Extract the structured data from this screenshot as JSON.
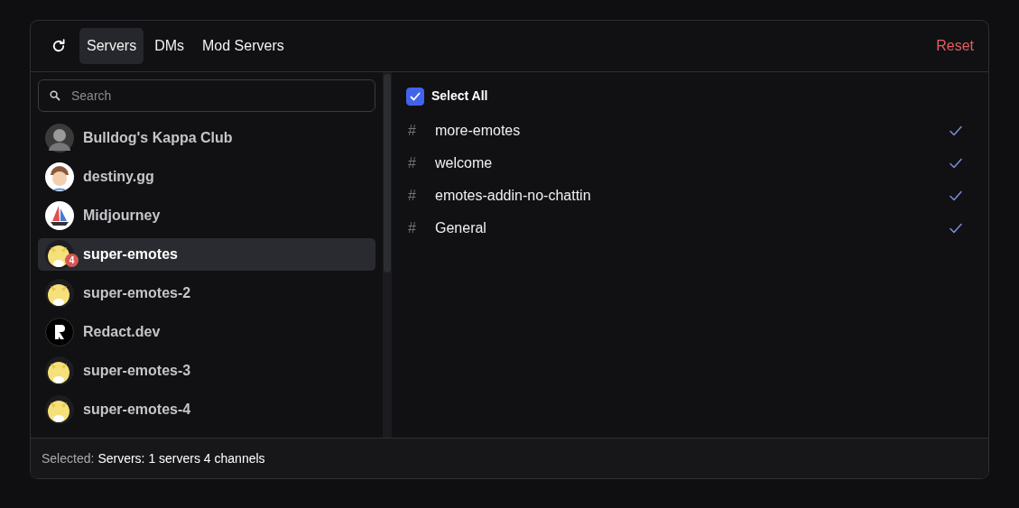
{
  "tabs": [
    {
      "label": "Servers",
      "selected": true
    },
    {
      "label": "DMs",
      "selected": false
    },
    {
      "label": "Mod Servers",
      "selected": false
    }
  ],
  "reset": "Reset",
  "search": {
    "placeholder": "Search"
  },
  "servers": [
    {
      "name": "Bulldog's Kappa Club",
      "kind": "person",
      "selected": false
    },
    {
      "name": "destiny.gg",
      "kind": "cartoon",
      "selected": false
    },
    {
      "name": "Midjourney",
      "kind": "boat",
      "selected": false
    },
    {
      "name": "super-emotes",
      "kind": "yellow",
      "selected": true,
      "badge": "4"
    },
    {
      "name": "super-emotes-2",
      "kind": "yellow",
      "selected": false
    },
    {
      "name": "Redact.dev",
      "kind": "dark",
      "selected": false
    },
    {
      "name": "super-emotes-3",
      "kind": "yellow",
      "selected": false
    },
    {
      "name": "super-emotes-4",
      "kind": "yellow",
      "selected": false
    }
  ],
  "select_all": {
    "label": "Select All",
    "checked": true
  },
  "channels": [
    {
      "prefix": "#",
      "name": "more-emotes",
      "checked": true
    },
    {
      "prefix": "#",
      "name": "welcome",
      "checked": true
    },
    {
      "prefix": "#",
      "name": "emotes-addin-no-chattin",
      "checked": true
    },
    {
      "prefix": "#",
      "name": "General",
      "checked": true
    }
  ],
  "status_bar": {
    "label": "Selected:",
    "value": "Servers: 1 servers 4 channels"
  }
}
